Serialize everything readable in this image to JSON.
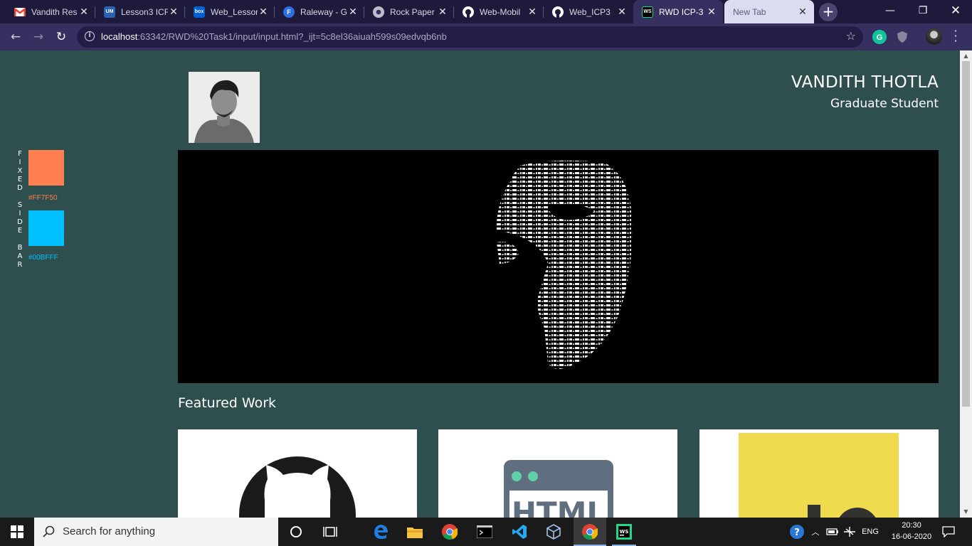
{
  "browser": {
    "tabs": [
      {
        "title": "Vandith Res",
        "icon": "gmail-icon",
        "color": "#ea4335"
      },
      {
        "title": "Lesson3 ICF",
        "icon": "umkc-icon",
        "color": "#2a63b6"
      },
      {
        "title": "Web_Lesson",
        "icon": "box-icon",
        "color": "#0061d5"
      },
      {
        "title": "Raleway - G",
        "icon": "google-fonts-icon",
        "color": "#2f6fe4"
      },
      {
        "title": "Rock Paper",
        "icon": "chrome-icon",
        "color": "#bbbbbb"
      },
      {
        "title": "Web-Mobil",
        "icon": "github-icon",
        "color": "#ffffff"
      },
      {
        "title": "Web_ICP3",
        "icon": "github-icon",
        "color": "#ffffff"
      },
      {
        "title": "RWD ICP-3",
        "icon": "webstorm-icon",
        "color": "#21d789"
      },
      {
        "title": "New Tab",
        "icon": "",
        "color": ""
      }
    ],
    "url_host": "localhost",
    "url_rest": ":63342/RWD%20Task1/input/input.html?_ijt=5c8el36aiuah599s09edvqb6nb"
  },
  "sidebar": {
    "vertical_text": "FIXED SIDE BAR",
    "swatches": [
      {
        "label": "#FF7F50",
        "color": "#ff7f50"
      },
      {
        "label": "#00BFFF",
        "color": "#00bfff"
      }
    ]
  },
  "header": {
    "name": "VANDITH THOTLA",
    "role": "Graduate Student"
  },
  "featured": {
    "heading": "Featured Work",
    "cards": [
      {
        "icon": "github-icon"
      },
      {
        "icon": "html-file-icon",
        "text": "HTML"
      },
      {
        "icon": "javascript-icon"
      }
    ]
  },
  "taskbar": {
    "search_placeholder": "Search for anything",
    "language": "ENG",
    "time": "20:30",
    "date": "16-06-2020"
  }
}
